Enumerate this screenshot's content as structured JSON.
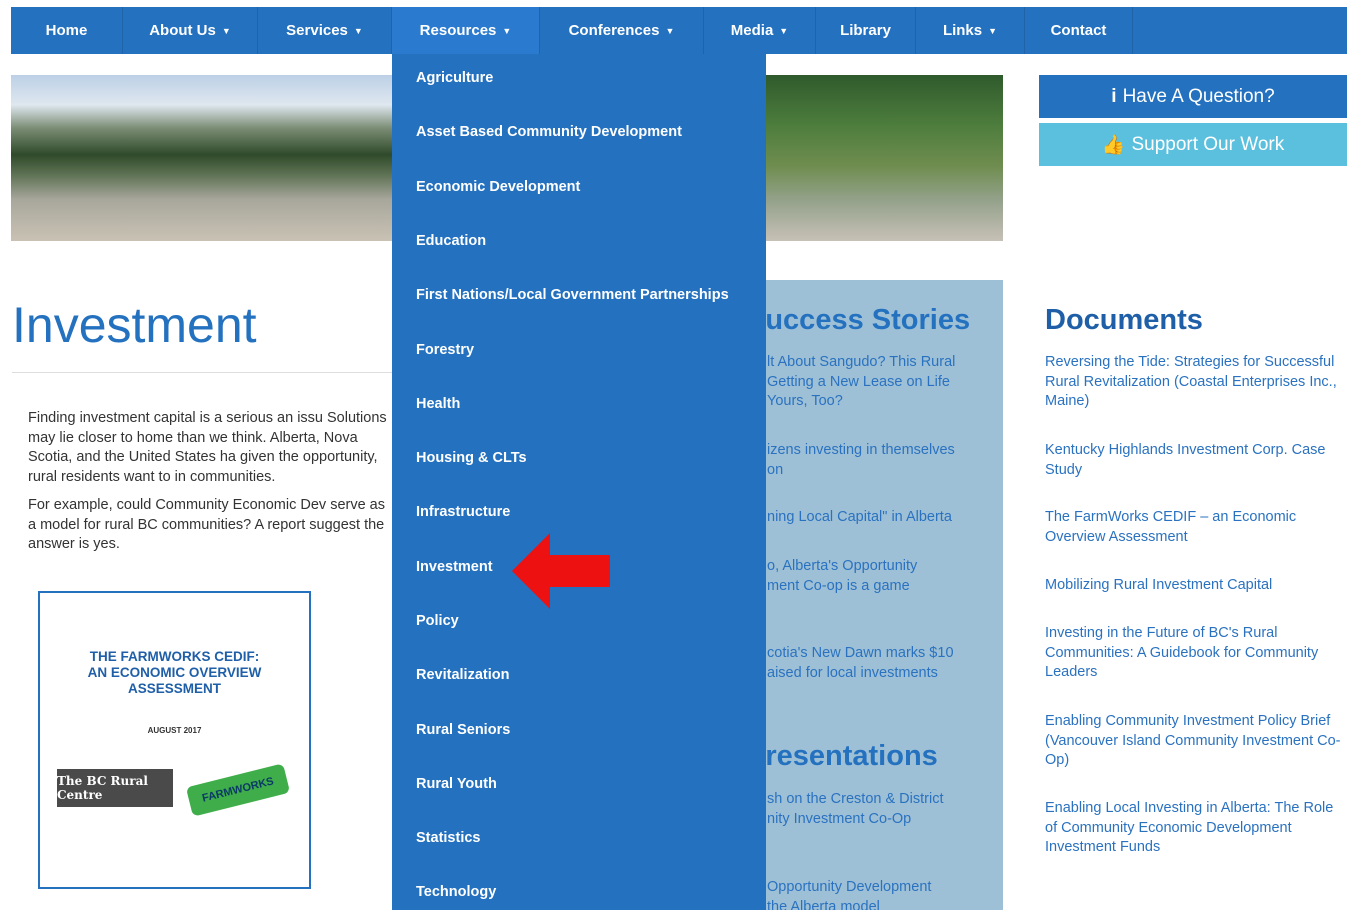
{
  "nav": {
    "items": [
      {
        "label": "Home",
        "caret": ""
      },
      {
        "label": "About Us",
        "caret": "▼"
      },
      {
        "label": "Services",
        "caret": "▼"
      },
      {
        "label": "Resources",
        "caret": "▼"
      },
      {
        "label": "Conferences",
        "caret": "▼"
      },
      {
        "label": "Media",
        "caret": "▼"
      },
      {
        "label": "Library",
        "caret": ""
      },
      {
        "label": "Links",
        "caret": "▼"
      },
      {
        "label": "Contact",
        "caret": ""
      }
    ],
    "active": "Resources"
  },
  "cta": {
    "question_icon": "i",
    "question_label": "Have A Question?",
    "support_icon": "👍",
    "support_label": "Support Our Work"
  },
  "page": {
    "title": "Investment",
    "intro_p1": "Finding investment capital  is a serious an issu Solutions may lie closer to home than we think. Alberta, Nova Scotia, and the United States ha given the opportunity, rural residents want to in communities.",
    "intro_p2": "For example, could Community Economic Dev serve as a model for rural BC communities? A report suggest the answer is yes."
  },
  "report_cover": {
    "title_line1": "THE FARMWORKS CEDIF:",
    "title_line2": "AN ECONOMIC OVERVIEW",
    "title_line3": "ASSESSMENT",
    "date": "AUGUST 2017",
    "logo1": "The BC Rural Centre",
    "logo2": "FARMWORKS"
  },
  "stories": {
    "heading": "Success Stories",
    "items": [
      [
        "lt About Sangudo? This Rural",
        "Getting a New Lease on Life",
        "Yours, Too?"
      ],
      [
        "izens investing in themselves",
        "on"
      ],
      [
        "ning Local Capital\" in Alberta"
      ],
      [
        "o, Alberta's Opportunity",
        "ment Co-op is a game"
      ],
      [
        "cotia's New Dawn marks $10",
        "aised for local investments"
      ]
    ],
    "pres_heading": "Presentations",
    "pres_items": [
      [
        "sh on the Creston & District",
        "nity Investment Co-Op"
      ],
      [
        "Opportunity Development",
        "the Alberta model"
      ]
    ]
  },
  "documents": {
    "heading": "Documents",
    "items": [
      "Reversing the Tide: Strategies for Successful Rural Revitalization (Coastal Enterprises Inc., Maine)",
      "Kentucky Highlands Investment Corp. Case Study",
      "The FarmWorks CEDIF – an Economic Overview Assessment",
      "Mobilizing Rural Investment Capital",
      "Investing in the Future of BC's Rural Communities: A Guidebook for Community Leaders",
      "Enabling Community Investment Policy Brief (Vancouver Island Community Investment Co-Op)",
      "Enabling Local Investing in Alberta: The Role of Community Economic Development Investment Funds"
    ]
  },
  "dropdown": {
    "items": [
      "Agriculture",
      "Asset Based Community Development",
      "Economic Development",
      "Education",
      "First Nations/Local Government Partnerships",
      "Forestry",
      "Health",
      "Housing & CLTs",
      "Infrastructure",
      "Investment",
      "Policy",
      "Revitalization",
      "Rural Seniors",
      "Rural Youth",
      "Statistics",
      "Technology"
    ]
  },
  "colors": {
    "nav_blue": "#2471bf",
    "cta_support": "#5bc0de",
    "stories_bg": "#9ec0d6",
    "arrow_red": "#ee1111"
  }
}
